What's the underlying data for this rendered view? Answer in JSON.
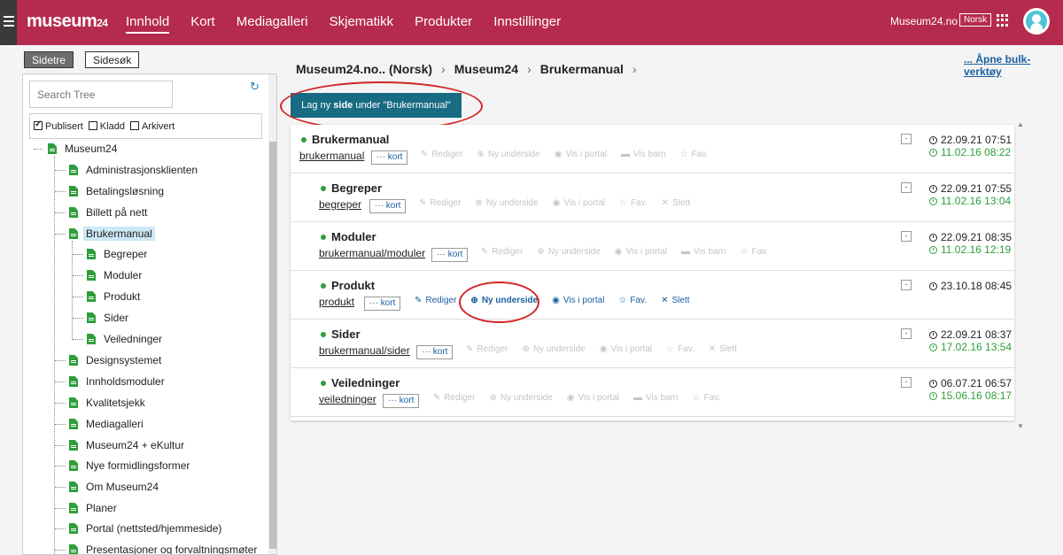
{
  "app": {
    "logo": "museum",
    "logo_suffix": "24",
    "site_name": "Museum24.no",
    "language": "Norsk"
  },
  "nav": {
    "items": [
      "Innhold",
      "Kort",
      "Mediagalleri",
      "Skjematikk",
      "Produkter",
      "Innstillinger"
    ],
    "active": "Innhold"
  },
  "left": {
    "tab_tree": "Sidetre",
    "tab_search": "Sidesøk",
    "search_placeholder": "Search Tree",
    "filters": [
      {
        "label": "Publisert",
        "checked": true
      },
      {
        "label": "Kladd",
        "checked": false
      },
      {
        "label": "Arkivert",
        "checked": false
      }
    ],
    "tree": {
      "root": "Museum24",
      "children": [
        "Administrasjonsklienten",
        "Betalingsløsning",
        "Billett på nett",
        "Brukermanual",
        "Begreper",
        "Moduler",
        "Produkt",
        "Sider",
        "Veiledninger",
        "Designsystemet",
        "Innholdsmoduler",
        "Kvalitetsjekk",
        "Mediagalleri",
        "Museum24 + eKultur",
        "Nye formidlingsformer",
        "Om Museum24",
        "Planer",
        "Portal (nettsted/hjemmeside)",
        "Presentasjoner og forvaltningsmøter"
      ],
      "selected": "Brukermanual"
    }
  },
  "main": {
    "breadcrumb": [
      "Museum24.no.. (Norsk)",
      "Museum24",
      "Brukermanual"
    ],
    "bulk_link": "... Åpne bulk-verktøy",
    "new_page": {
      "prefix": "Lag ny ",
      "bold": "side",
      "suffix": " under \"Brukermanual\""
    },
    "action_labels": {
      "kort": "kort",
      "rediger": "Rediger",
      "ny_underside": "Ny underside",
      "vis_i_portal": "Vis i portal",
      "vis_barn": "Vis barn",
      "fav": "Fav.",
      "slett": "Slett"
    },
    "collapse_symbol": "-",
    "rows": [
      {
        "title": "Brukermanual",
        "slug": "brukermanual",
        "date_modified": "22.09.21 07:51",
        "date_published": "11.02.16 08:22"
      },
      {
        "title": "Begreper",
        "slug": "begreper",
        "date_modified": "22.09.21 07:55",
        "date_published": "11.02.16 13:04"
      },
      {
        "title": "Moduler",
        "slug": "brukermanual/moduler",
        "date_modified": "22.09.21 08:35",
        "date_published": "11.02.16 12:19"
      },
      {
        "title": "Produkt",
        "slug": "produkt",
        "date_modified": "23.10.18 08:45",
        "date_published": ""
      },
      {
        "title": "Sider",
        "slug": "brukermanual/sider",
        "date_modified": "22.09.21 08:37",
        "date_published": "17.02.16 13:54"
      },
      {
        "title": "Veiledninger",
        "slug": "veiledninger",
        "date_modified": "06.07.21 06:57",
        "date_published": "15.06.16 08:17"
      }
    ]
  },
  "colors": {
    "topbar": "#b52b4e",
    "button": "#176b83",
    "link": "#1a5fa0",
    "published_green": "#2e9e3a",
    "highlight_red": "#d42424"
  }
}
